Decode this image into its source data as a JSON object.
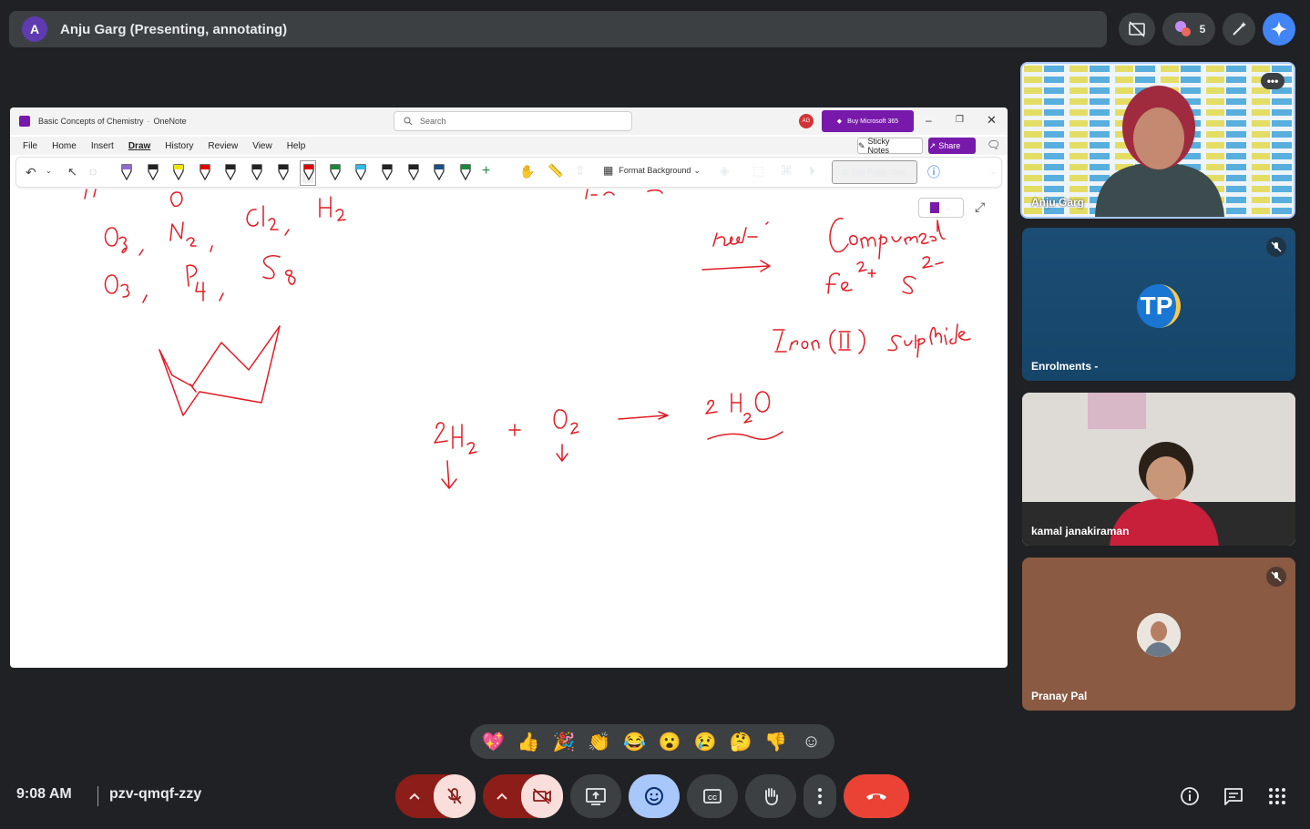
{
  "presenter_bar": {
    "avatar_letter": "A",
    "text": "Anju Garg (Presenting, annotating)",
    "participants_count": "5"
  },
  "onenote": {
    "title": "Basic Concepts of Chemistry",
    "app": "OneNote",
    "search_placeholder": "Search",
    "account_initials": "AG",
    "buy_label": "Buy Microsoft 365",
    "menu": [
      "File",
      "Home",
      "Insert",
      "Draw",
      "History",
      "Review",
      "View",
      "Help"
    ],
    "active_menu": "Draw",
    "sticky_notes": "Sticky Notes",
    "share": "Share",
    "format_background": "Format Background",
    "full_page_view": "Full Page View",
    "pen_colors": [
      "#8e6cc9",
      "#222222",
      "#f2e600",
      "#e00000",
      "#222222",
      "#222222",
      "#222222",
      "#e00000",
      "#1b8a3a",
      "#38b6e8",
      "#222222",
      "#222222",
      "#1a4f8a",
      "#1b8a3a"
    ],
    "ink_color": "#e31b23"
  },
  "tiles": [
    {
      "name": "Anju Garg"
    },
    {
      "name": "Enrolments -",
      "logo_text": "TP"
    },
    {
      "name": "kamal janakiraman"
    },
    {
      "name": "Pranay Pal"
    }
  ],
  "reactions": [
    "💖",
    "👍",
    "🎉",
    "👏",
    "😂",
    "😮",
    "😢",
    "🤔",
    "👎"
  ],
  "footer": {
    "time": "9:08 AM",
    "meeting_code": "pzv-qmqf-zzy"
  },
  "colors": {
    "end_call": "#ea4335",
    "muted": "#f9dedc",
    "muted_dark": "#8c1d18",
    "emoji_active": "#a8c7fa",
    "accent_purple": "#7719aa"
  }
}
